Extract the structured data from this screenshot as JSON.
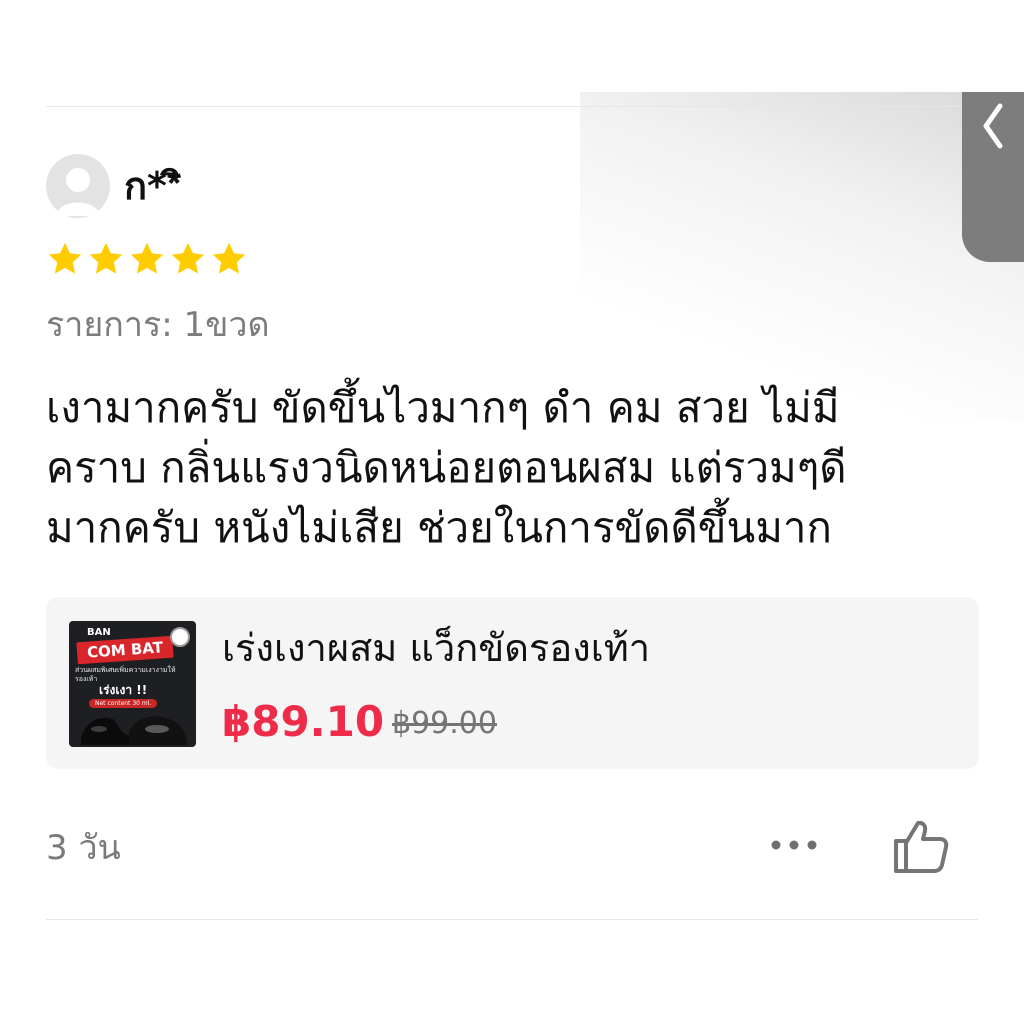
{
  "review": {
    "username": "ก**ิ",
    "rating": 5,
    "variation": "รายการ: 1ขวด",
    "text_lines": [
      "เงามากครับ ขัดขึ้นไวมากๆ ดำ คม สวย ไม่มี",
      "คราบ กลิ่นแรงวนิดหน่อยตอนผสม แต่รวมๆดี",
      "มากครับ หนังไม่เสีย ช่วยในการขัดดีขึ้นมาก"
    ],
    "time_ago": "3 วัน"
  },
  "product": {
    "name": "เร่งเงาผสม แว็กขัดรองเท้า",
    "price": "฿89.10",
    "original_price": "฿99.00",
    "thumbnail": {
      "brand_small": "BAN",
      "brand": "COM BAT",
      "small_text": "ส่วนผสมพิเศษเพิ่มความเงางามให้รองเท้า",
      "title": "เร่งเงา !!",
      "pill": "Net content 30 ml."
    }
  },
  "colors": {
    "star": "#FFCC00",
    "price": "#EE2C4A",
    "muted_text": "#7A7A7A",
    "card_bg": "#F5F5F5",
    "back_tab": "#7D7D7D"
  },
  "icons": {
    "back": "chevron-left-icon",
    "more": "ellipsis-icon",
    "like": "thumbs-up-icon",
    "avatar": "user-avatar-icon"
  }
}
